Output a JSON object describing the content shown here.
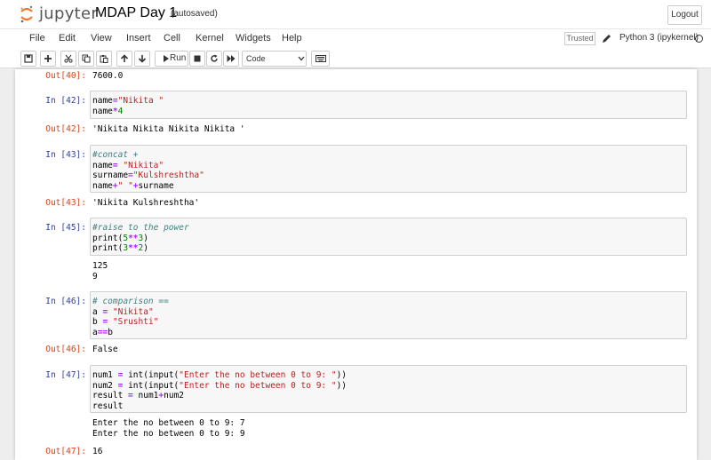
{
  "header": {
    "logo_text": "jupyter",
    "notebook_name": "MDAP Day 1",
    "autosave_status": "(autosaved)",
    "logout_label": "Logout"
  },
  "menu": {
    "items": [
      "File",
      "Edit",
      "View",
      "Insert",
      "Cell",
      "Kernel",
      "Widgets",
      "Help"
    ],
    "trusted_label": "Trusted",
    "kernel_name": "Python 3 (ipykernel)"
  },
  "toolbar": {
    "run_label": "Run",
    "cell_type": "Code"
  },
  "cells": {
    "out40": {
      "prompt": "Out[40]:",
      "text": "7600.0"
    },
    "c42": {
      "prompt": "In [42]:",
      "code": "name=\"Nikita \"\nname*4",
      "out_prompt": "Out[42]:",
      "output": "'Nikita Nikita Nikita Nikita '"
    },
    "c43": {
      "prompt": "In [43]:",
      "code": "#concat +\nname= \"Nikita\"\nsurname=\"Kulshreshtha\"\nname+\" \"+surname",
      "out_prompt": "Out[43]:",
      "output": "'Nikita Kulshreshtha'"
    },
    "c45": {
      "prompt": "In [45]:",
      "code": "#raise to the power\nprint(5**3)\nprint(3**2)",
      "output": "125\n9"
    },
    "c46": {
      "prompt": "In [46]:",
      "code": "# comparison ==\na = \"Nikita\"\nb = \"Srushti\"\na==b",
      "out_prompt": "Out[46]:",
      "output": "False"
    },
    "c47": {
      "prompt": "In [47]:",
      "code": "num1 = int(input(\"Enter the no between 0 to 9: \"))\nnum2 = int(input(\"Enter the no between 0 to 9: \"))\nresult = num1+num2\nresult",
      "stdout": "Enter the no between 0 to 9: 7\nEnter the no between 0 to 9: 9",
      "out_prompt": "Out[47]:",
      "output": "16"
    }
  }
}
